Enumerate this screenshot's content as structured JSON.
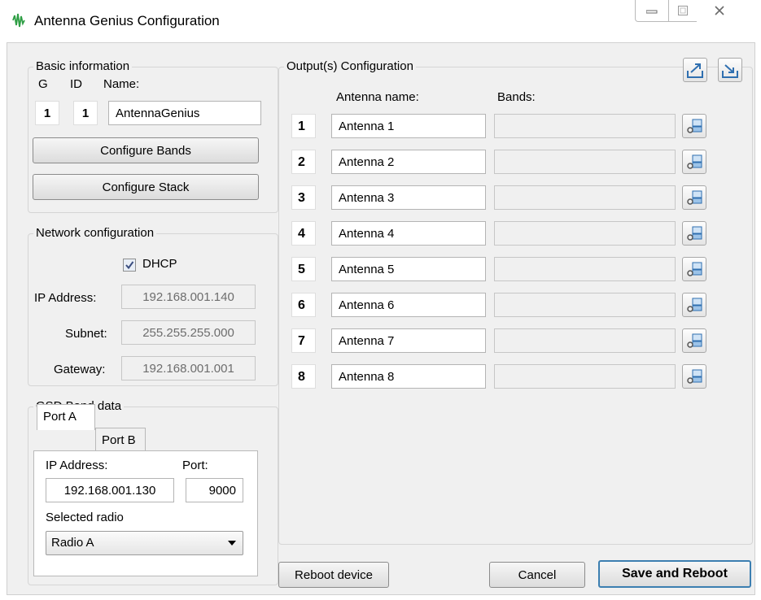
{
  "window": {
    "title": "Antenna Genius Configuration",
    "controls": {
      "minimize": "—",
      "maximize": "☐",
      "close": "✕"
    }
  },
  "basic": {
    "legend": "Basic information",
    "g_label": "G",
    "id_label": "ID",
    "name_label": "Name:",
    "g_value": "1",
    "id_value": "1",
    "name_value": "AntennaGenius",
    "configure_bands": "Configure Bands",
    "configure_stack": "Configure Stack"
  },
  "network": {
    "legend": "Network configuration",
    "dhcp_label": "DHCP",
    "dhcp_checked": true,
    "ip_label": "IP Address:",
    "ip_value": "192.168.001.140",
    "subnet_label": "Subnet:",
    "subnet_value": "255.255.255.000",
    "gateway_label": "Gateway:",
    "gateway_value": "192.168.001.001"
  },
  "gsd": {
    "legend": "GSD Band data",
    "tabs": [
      "Port A",
      "Port B"
    ],
    "active_tab": "Port A",
    "ip_label": "IP Address:",
    "ip_value": "192.168.001.130",
    "port_label": "Port:",
    "port_value": "9000",
    "radio_label": "Selected radio",
    "radio_value": "Radio A"
  },
  "outputs": {
    "legend": "Output(s) Configuration",
    "antenna_header": "Antenna name:",
    "bands_header": "Bands:",
    "rows": [
      {
        "num": "1",
        "name": "Antenna 1",
        "bands": ""
      },
      {
        "num": "2",
        "name": "Antenna 2",
        "bands": ""
      },
      {
        "num": "3",
        "name": "Antenna 3",
        "bands": ""
      },
      {
        "num": "4",
        "name": "Antenna 4",
        "bands": ""
      },
      {
        "num": "5",
        "name": "Antenna 5",
        "bands": ""
      },
      {
        "num": "6",
        "name": "Antenna 6",
        "bands": ""
      },
      {
        "num": "7",
        "name": "Antenna 7",
        "bands": ""
      },
      {
        "num": "8",
        "name": "Antenna 8",
        "bands": ""
      }
    ]
  },
  "footer": {
    "reboot": "Reboot device",
    "cancel": "Cancel",
    "save": "Save and Reboot"
  }
}
